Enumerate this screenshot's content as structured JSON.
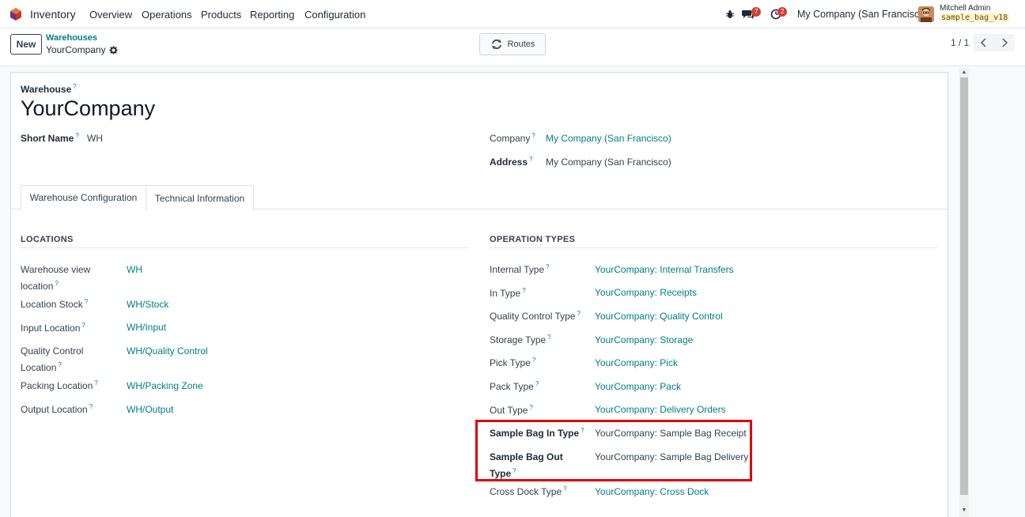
{
  "navbar": {
    "app_name": "Inventory",
    "menus": [
      "Overview",
      "Operations",
      "Products",
      "Reporting",
      "Configuration"
    ],
    "messages_count": "7",
    "activities_count": "2",
    "company": "My Company (San Francisco)",
    "user_name": "Mitchell Admin",
    "db_name": "sample_bag_v18"
  },
  "control": {
    "new_label": "New",
    "breadcrumb_parent": "Warehouses",
    "breadcrumb_current": "YourCompany",
    "routes_label": "Routes",
    "pager": "1 / 1"
  },
  "form": {
    "warehouse_label": "Warehouse",
    "warehouse_name": "YourCompany",
    "short_name_label": "Short Name",
    "short_name_value": "WH",
    "company_label": "Company",
    "company_value": "My Company (San Francisco)",
    "address_label": "Address",
    "address_value": "My Company (San Francisco)",
    "tabs": [
      "Warehouse Configuration",
      "Technical Information"
    ],
    "locations_title": "LOCATIONS",
    "locations": [
      {
        "label_1": "Warehouse view",
        "label_2": "location",
        "value": "WH"
      },
      {
        "label_1": "Location Stock",
        "value": "WH/Stock"
      },
      {
        "label_1": "Input Location",
        "value": "WH/Input"
      },
      {
        "label_1": "Quality Control",
        "label_2": "Location",
        "value": "WH/Quality Control"
      },
      {
        "label_1": "Packing Location",
        "value": "WH/Packing Zone"
      },
      {
        "label_1": "Output Location",
        "value": "WH/Output"
      }
    ],
    "operation_types_title": "OPERATION TYPES",
    "operation_types": [
      {
        "label_1": "Internal Type",
        "value": "YourCompany: Internal Transfers"
      },
      {
        "label_1": "In Type",
        "value": "YourCompany: Receipts"
      },
      {
        "label_1": "Quality Control Type",
        "value": "YourCompany: Quality Control"
      },
      {
        "label_1": "Storage Type",
        "value": "YourCompany: Storage"
      },
      {
        "label_1": "Pick Type",
        "value": "YourCompany: Pick"
      },
      {
        "label_1": "Pack Type",
        "value": "YourCompany: Pack"
      },
      {
        "label_1": "Out Type",
        "value": "YourCompany: Delivery Orders"
      },
      {
        "label_1": "Sample Bag In Type",
        "value": "YourCompany: Sample Bag Receipt"
      },
      {
        "label_1": "Sample Bag Out",
        "label_2": "Type",
        "value": "YourCompany: Sample Bag Delivery"
      },
      {
        "label_1": "Cross Dock Type",
        "value": "YourCompany: Cross Dock"
      }
    ]
  },
  "colors": {
    "accent": "#017e84",
    "highlight": "#e00000",
    "badge": "#d23f3a"
  }
}
